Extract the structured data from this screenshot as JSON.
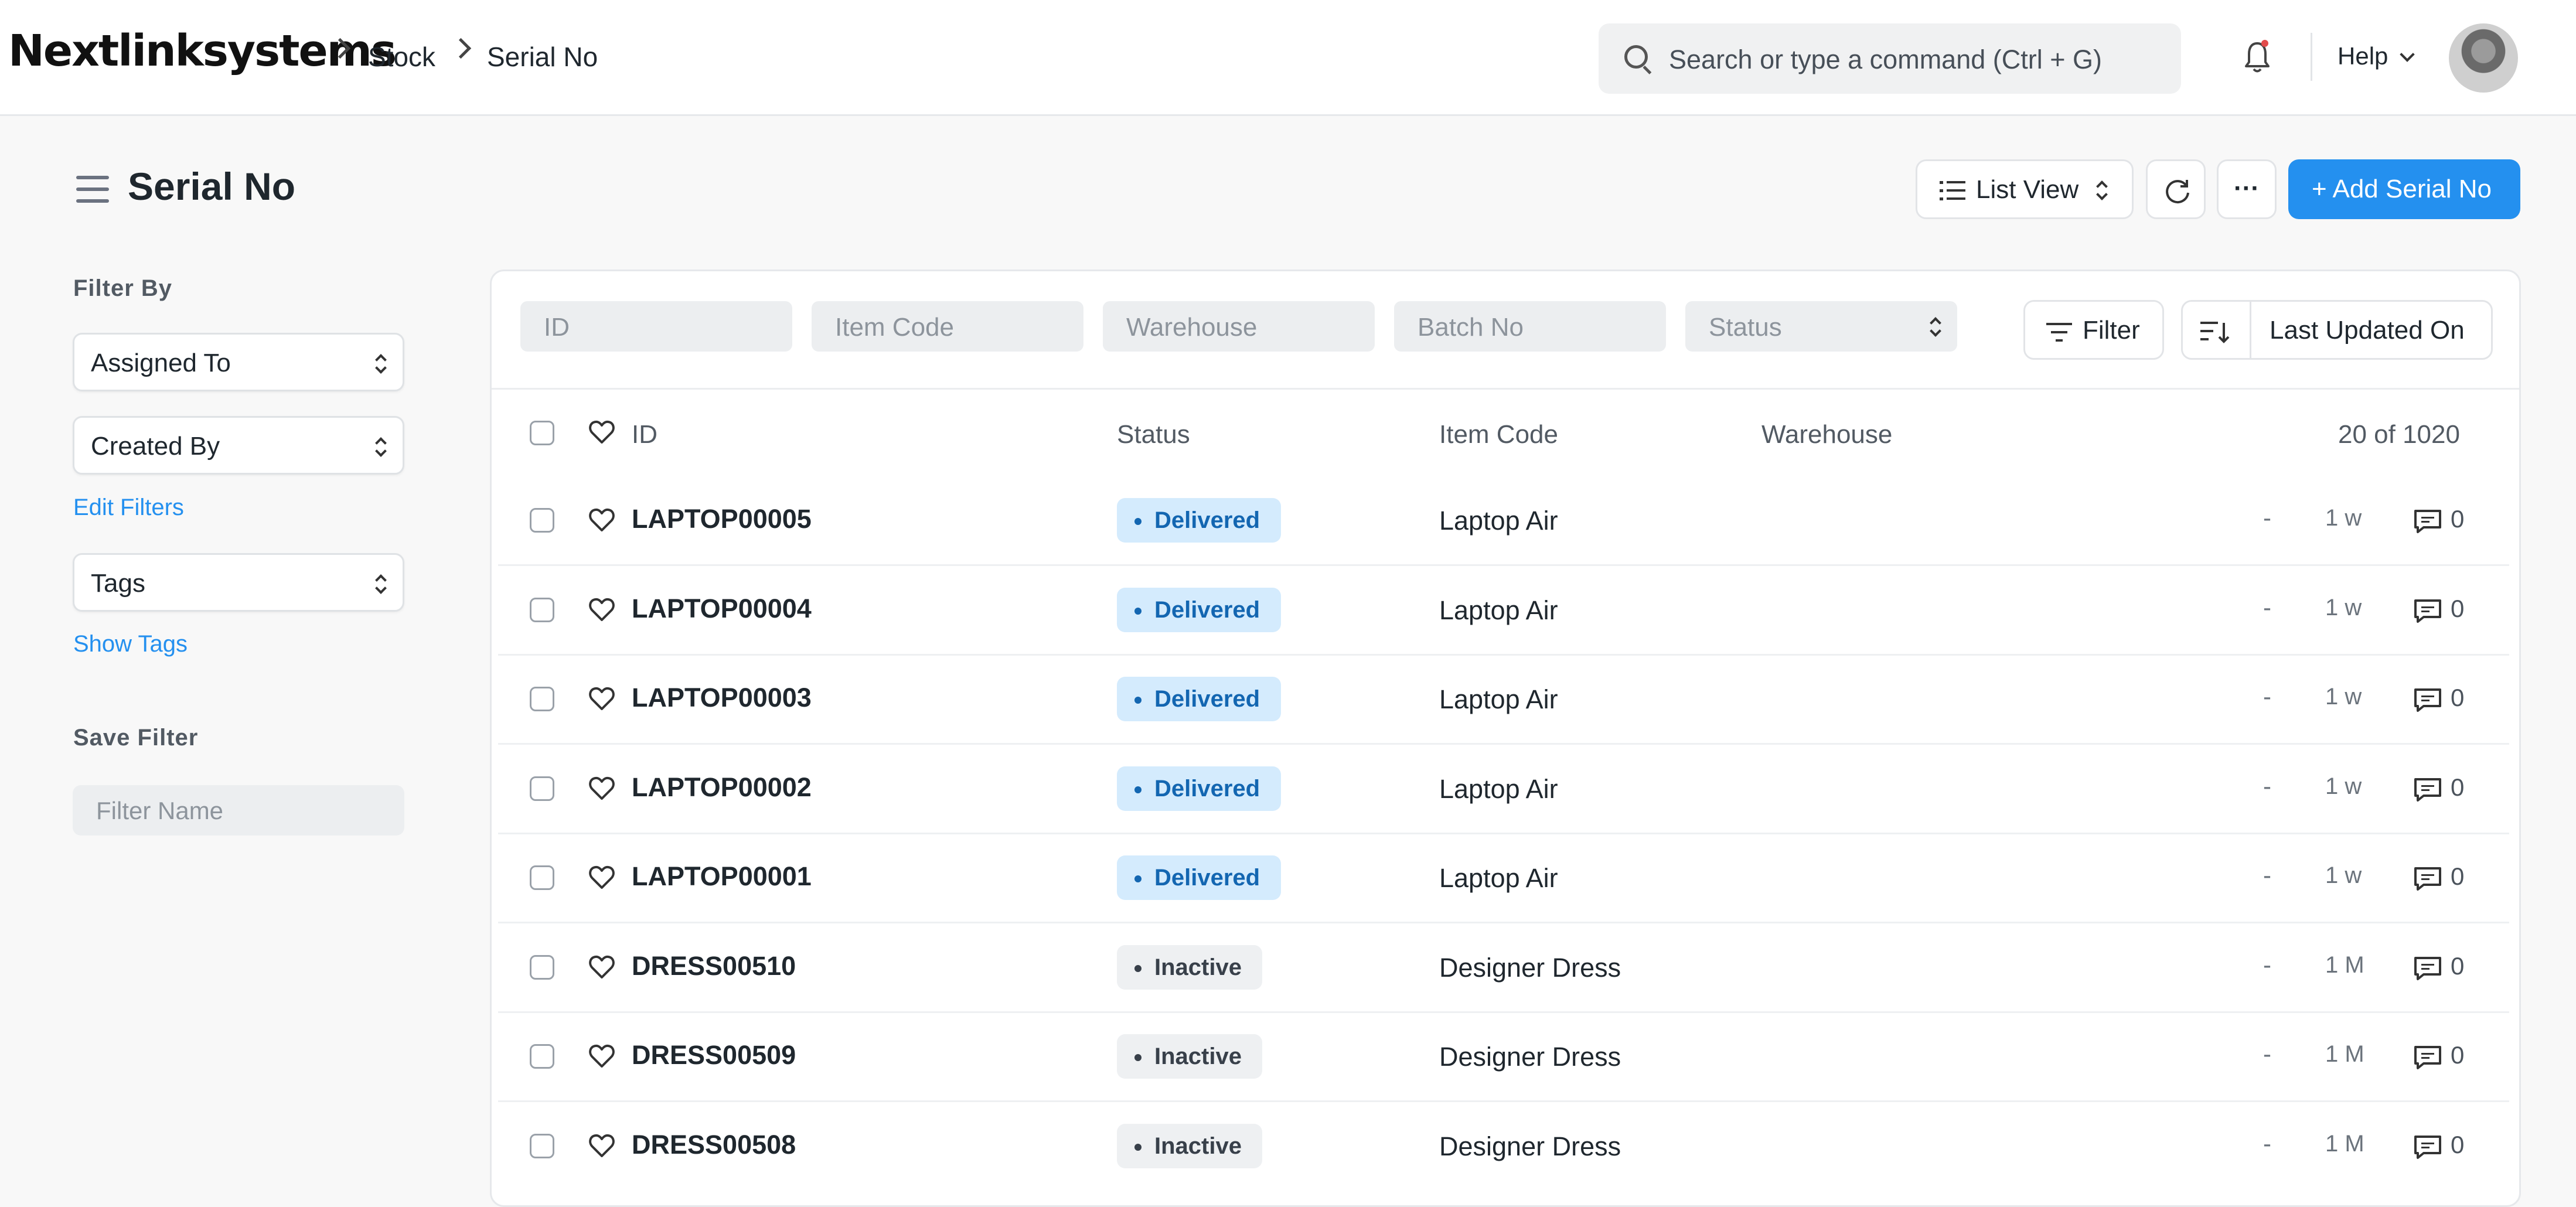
{
  "navbar": {
    "brand": "Nextlinksystems",
    "breadcrumbs": [
      "Stock",
      "Serial No"
    ],
    "search_placeholder": "Search or type a command (Ctrl + G)",
    "help_label": "Help"
  },
  "page": {
    "title": "Serial No",
    "view_label": "List View",
    "more_label": "···",
    "add_label": "+ Add Serial No"
  },
  "sidebar": {
    "filter_by_label": "Filter By",
    "assigned_to": "Assigned To",
    "created_by": "Created By",
    "edit_filters": "Edit Filters",
    "tags": "Tags",
    "show_tags": "Show Tags",
    "save_filter_label": "Save Filter",
    "filter_name_placeholder": "Filter Name"
  },
  "filters": {
    "id_placeholder": "ID",
    "item_code_placeholder": "Item Code",
    "warehouse_placeholder": "Warehouse",
    "batch_no_placeholder": "Batch No",
    "status_placeholder": "Status",
    "filter_button": "Filter",
    "sort_label": "Last Updated On"
  },
  "table": {
    "columns": {
      "id": "ID",
      "status": "Status",
      "item_code": "Item Code",
      "warehouse": "Warehouse"
    },
    "count_label": "20 of 1020",
    "rows": [
      {
        "id": "LAPTOP00005",
        "status": "Delivered",
        "item_code": "Laptop Air",
        "dash": "-",
        "age": "1 w",
        "comments": "0"
      },
      {
        "id": "LAPTOP00004",
        "status": "Delivered",
        "item_code": "Laptop Air",
        "dash": "-",
        "age": "1 w",
        "comments": "0"
      },
      {
        "id": "LAPTOP00003",
        "status": "Delivered",
        "item_code": "Laptop Air",
        "dash": "-",
        "age": "1 w",
        "comments": "0"
      },
      {
        "id": "LAPTOP00002",
        "status": "Delivered",
        "item_code": "Laptop Air",
        "dash": "-",
        "age": "1 w",
        "comments": "0"
      },
      {
        "id": "LAPTOP00001",
        "status": "Delivered",
        "item_code": "Laptop Air",
        "dash": "-",
        "age": "1 w",
        "comments": "0"
      },
      {
        "id": "DRESS00510",
        "status": "Inactive",
        "item_code": "Designer Dress",
        "dash": "-",
        "age": "1 M",
        "comments": "0"
      },
      {
        "id": "DRESS00509",
        "status": "Inactive",
        "item_code": "Designer Dress",
        "dash": "-",
        "age": "1 M",
        "comments": "0"
      },
      {
        "id": "DRESS00508",
        "status": "Inactive",
        "item_code": "Designer Dress",
        "dash": "-",
        "age": "1 M",
        "comments": "0"
      }
    ]
  },
  "colors": {
    "accent": "#2490ef",
    "delivered_bg": "#d4ebfd",
    "delivered_text": "#1366b1",
    "inactive_bg": "#eef0f2",
    "notification_dot": "#e24c4c"
  }
}
